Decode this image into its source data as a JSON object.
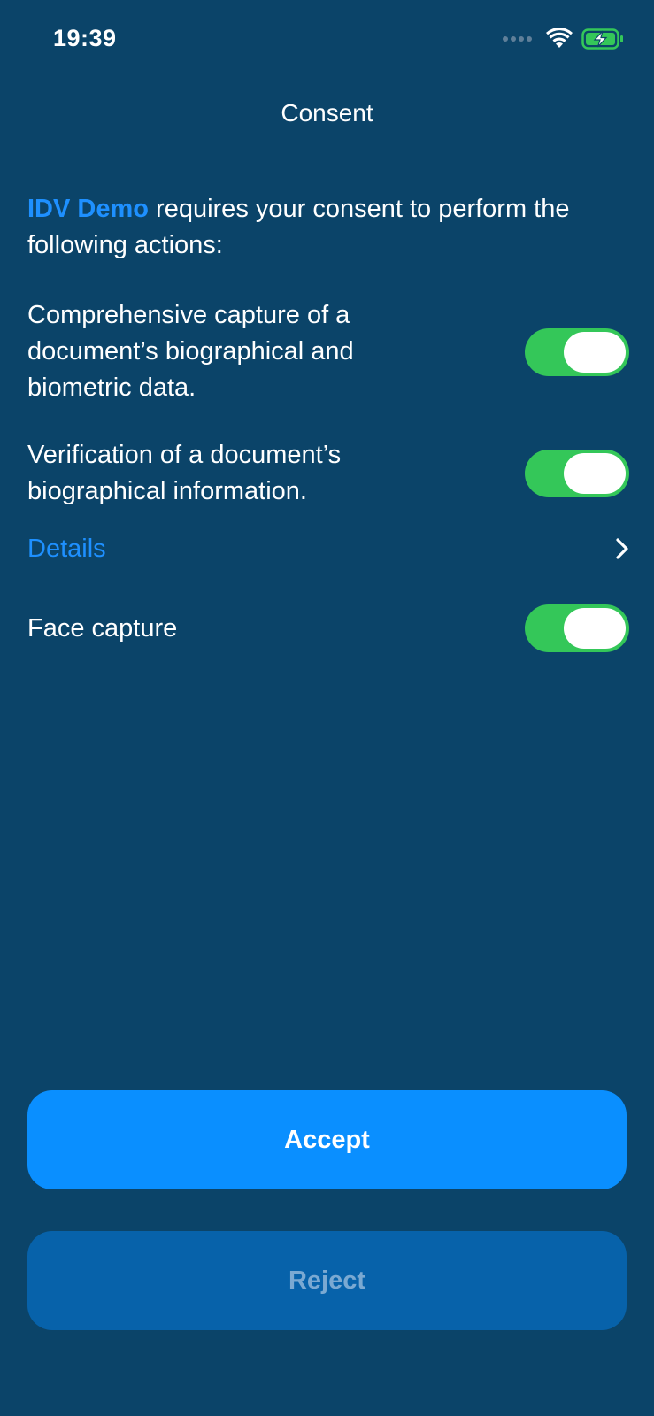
{
  "status_bar": {
    "time": "19:39",
    "icons": [
      "signal-dots-icon",
      "wifi-icon",
      "battery-charging-icon"
    ],
    "battery_color": "#34c759"
  },
  "nav": {
    "title": "Consent"
  },
  "intro": {
    "app_name": "IDV Demo",
    "text": " requires your consent to perform the following actions:"
  },
  "consents": [
    {
      "label": "Comprehensive capture of a document’s biographical and biometric data.",
      "enabled": true
    },
    {
      "label": "Verification of a document’s biographical information.",
      "enabled": true
    },
    {
      "label": "Face capture",
      "enabled": true
    }
  ],
  "details": {
    "label": "Details",
    "icon": "chevron-right-icon"
  },
  "buttons": {
    "accept": "Accept",
    "reject": "Reject"
  },
  "colors": {
    "background": "#0b4469",
    "accent": "#1e90ff",
    "toggle_on": "#34c759",
    "accept_bg": "#0a8fff",
    "reject_bg": "#0762aa"
  }
}
